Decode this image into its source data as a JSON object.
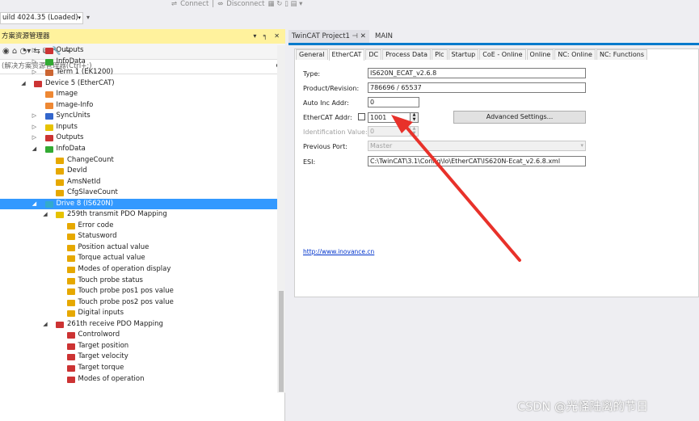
{
  "toolbar": {
    "build_combo": "uild 4024.35 (Loaded)",
    "connect": "Connect",
    "disconnect": "Disconnect"
  },
  "solution_explorer": {
    "title": "方案资源管理器",
    "title_buttons": "▾ ╕ ✕",
    "search_placeholder": "(解决方案资源管理器(Ctrl+;)",
    "tree": [
      {
        "label": "Outputs",
        "indent": 3,
        "expander": "▷",
        "icon": "output-icon",
        "color": "#cc3333"
      },
      {
        "label": "InfoData",
        "indent": 3,
        "expander": "▷",
        "icon": "infodata-icon",
        "color": "#33aa33"
      },
      {
        "label": "Term 1 (EK1200)",
        "indent": 3,
        "expander": "▷",
        "icon": "terminal-icon",
        "color": "#cc6633"
      },
      {
        "label": "Device 5 (EtherCAT)",
        "indent": 2,
        "expander": "◢",
        "icon": "device-icon",
        "color": "#cc3333"
      },
      {
        "label": "Image",
        "indent": 3,
        "expander": "",
        "icon": "image-icon",
        "color": "#ee8833"
      },
      {
        "label": "Image-Info",
        "indent": 3,
        "expander": "",
        "icon": "image-info-icon",
        "color": "#ee8833"
      },
      {
        "label": "SyncUnits",
        "indent": 3,
        "expander": "▷",
        "icon": "syncunits-icon",
        "color": "#3366cc"
      },
      {
        "label": "Inputs",
        "indent": 3,
        "expander": "▷",
        "icon": "input-icon",
        "color": "#e6c200"
      },
      {
        "label": "Outputs",
        "indent": 3,
        "expander": "▷",
        "icon": "output-icon",
        "color": "#cc3333"
      },
      {
        "label": "InfoData",
        "indent": 3,
        "expander": "◢",
        "icon": "infodata-icon",
        "color": "#33aa33"
      },
      {
        "label": "ChangeCount",
        "indent": 4,
        "expander": "",
        "icon": "var-icon",
        "color": "#e6a800"
      },
      {
        "label": "DevId",
        "indent": 4,
        "expander": "",
        "icon": "var-icon",
        "color": "#e6a800"
      },
      {
        "label": "AmsNetId",
        "indent": 4,
        "expander": "",
        "icon": "var-icon",
        "color": "#e6a800"
      },
      {
        "label": "CfgSlaveCount",
        "indent": 4,
        "expander": "",
        "icon": "var-icon",
        "color": "#e6a800"
      },
      {
        "label": "Drive 8 (IS620N)",
        "indent": 3,
        "expander": "◢",
        "icon": "drive-icon",
        "color": "#33aacc",
        "selected": true
      },
      {
        "label": "259th transmit PDO Mapping",
        "indent": 4,
        "expander": "◢",
        "icon": "input-icon",
        "color": "#e6c200"
      },
      {
        "label": "Error code",
        "indent": 5,
        "expander": "",
        "icon": "var-icon",
        "color": "#e6a800"
      },
      {
        "label": "Statusword",
        "indent": 5,
        "expander": "",
        "icon": "var-icon",
        "color": "#e6a800"
      },
      {
        "label": "Position actual value",
        "indent": 5,
        "expander": "",
        "icon": "var-icon",
        "color": "#e6a800"
      },
      {
        "label": "Torque actual value",
        "indent": 5,
        "expander": "",
        "icon": "var-icon",
        "color": "#e6a800"
      },
      {
        "label": "Modes of operation display",
        "indent": 5,
        "expander": "",
        "icon": "var-icon",
        "color": "#e6a800"
      },
      {
        "label": "Touch probe status",
        "indent": 5,
        "expander": "",
        "icon": "var-icon",
        "color": "#e6a800"
      },
      {
        "label": "Touch probe pos1 pos value",
        "indent": 5,
        "expander": "",
        "icon": "var-icon",
        "color": "#e6a800"
      },
      {
        "label": "Touch probe pos2 pos value",
        "indent": 5,
        "expander": "",
        "icon": "var-icon",
        "color": "#e6a800"
      },
      {
        "label": "Digital inputs",
        "indent": 5,
        "expander": "",
        "icon": "var-icon",
        "color": "#e6a800"
      },
      {
        "label": "261th receive PDO Mapping",
        "indent": 4,
        "expander": "◢",
        "icon": "output-icon",
        "color": "#cc3333"
      },
      {
        "label": "Controlword",
        "indent": 5,
        "expander": "",
        "icon": "outvar-icon",
        "color": "#cc3333"
      },
      {
        "label": "Target position",
        "indent": 5,
        "expander": "",
        "icon": "outvar-icon",
        "color": "#cc3333"
      },
      {
        "label": "Target velocity",
        "indent": 5,
        "expander": "",
        "icon": "outvar-icon",
        "color": "#cc3333"
      },
      {
        "label": "Target torque",
        "indent": 5,
        "expander": "",
        "icon": "outvar-icon",
        "color": "#cc3333"
      },
      {
        "label": "Modes of operation",
        "indent": 5,
        "expander": "",
        "icon": "outvar-icon",
        "color": "#cc3333"
      }
    ]
  },
  "doc_tabs": {
    "project": "TwinCAT Project1",
    "project_pin": "⊣",
    "project_close": "✕",
    "main": "MAIN"
  },
  "property_tabs": [
    "General",
    "EtherCAT",
    "DC",
    "Process Data",
    "Plc",
    "Startup",
    "CoE - Online",
    "Online",
    "NC: Online",
    "NC: Functions"
  ],
  "active_tab": "EtherCAT",
  "form": {
    "type_label": "Type:",
    "type_value": "IS620N_ECAT_v2.6.8",
    "product_label": "Product/Revision:",
    "product_value": "786696 / 65537",
    "auto_inc_label": "Auto Inc Addr:",
    "auto_inc_value": "0",
    "ethercat_addr_label": "EtherCAT Addr:",
    "ethercat_addr_value": "1001",
    "ident_label": "Identification Value:",
    "ident_value": "0",
    "prev_port_label": "Previous Port:",
    "prev_port_value": "Master",
    "esi_label": "ESI:",
    "esi_value": "C:\\TwinCAT\\3.1\\Config\\Io\\EtherCAT\\IS620N-Ecat_v2.6.8.xml",
    "advanced_button": "Advanced Settings...",
    "link": "http://www.inovance.cn"
  },
  "annotation": {
    "arrow_color": "#e8312a"
  },
  "watermark": "CSDN @光怪陆离的节日"
}
